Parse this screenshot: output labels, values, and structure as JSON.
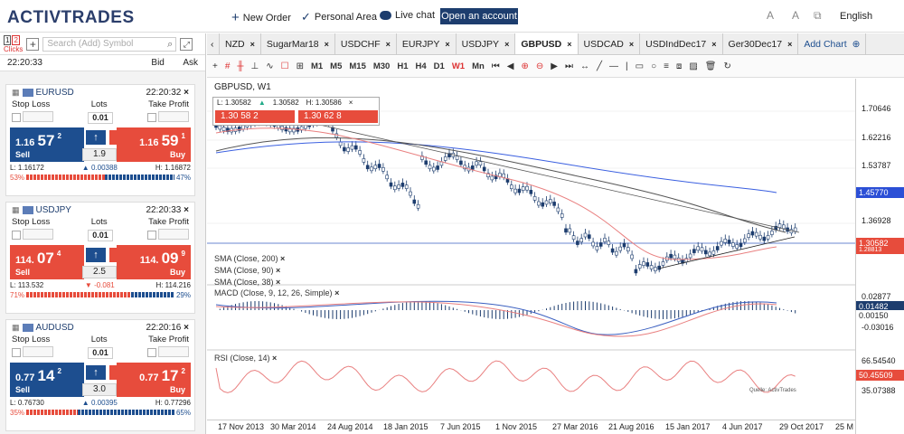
{
  "brand": {
    "logo": "ACTIVTRADES"
  },
  "top": {
    "new_order": "New Order",
    "personal_area": "Personal Area",
    "live_chat": "Live chat",
    "open_account": "Open an account",
    "language": "English"
  },
  "sidebar": {
    "clicks": "Clicks",
    "search_placeholder": "Search (Add) Symbol",
    "time": "22:20:33",
    "bid": "Bid",
    "ask": "Ask",
    "cards": [
      {
        "symbol": "EURUSD",
        "time": "22:20:32",
        "stop_loss": "Stop Loss",
        "lots_label": "Lots",
        "take_profit": "Take Profit",
        "lots": "0.01",
        "sell_int": "1.16",
        "sell_big": "57",
        "sell_sup": "2",
        "buy_int": "1.16",
        "buy_big": "59",
        "buy_sup": "1",
        "sell": "Sell",
        "buy": "Buy",
        "lot_value": "1.9",
        "low": "L: 1.16172",
        "change": "0.00388",
        "high": "H: 1.16872",
        "pct_sell": "53%",
        "pct_buy": "47%",
        "sell_color": "#1d4e8f",
        "buy_color": "#e74c3c"
      },
      {
        "symbol": "USDJPY",
        "time": "22:20:33",
        "stop_loss": "Stop Loss",
        "lots_label": "Lots",
        "take_profit": "Take Profit",
        "lots": "0.01",
        "sell_int": "114.",
        "sell_big": "07",
        "sell_sup": "4",
        "buy_int": "114.",
        "buy_big": "09",
        "buy_sup": "9",
        "sell": "Sell",
        "buy": "Buy",
        "lot_value": "2.5",
        "low": "L: 113.532",
        "change": "-0.081",
        "high": "H: 114.216",
        "pct_sell": "71%",
        "pct_buy": "29%",
        "sell_color": "#e74c3c",
        "buy_color": "#e74c3c"
      },
      {
        "symbol": "AUDUSD",
        "time": "22:20:16",
        "stop_loss": "Stop Loss",
        "lots_label": "Lots",
        "take_profit": "Take Profit",
        "lots": "0.01",
        "sell_int": "0.77",
        "sell_big": "14",
        "sell_sup": "2",
        "buy_int": "0.77",
        "buy_big": "17",
        "buy_sup": "2",
        "sell": "Sell",
        "buy": "Buy",
        "lot_value": "3.0",
        "low": "L: 0.76730",
        "change": "0.00395",
        "high": "H: 0.77296",
        "pct_sell": "35%",
        "pct_buy": "65%",
        "sell_color": "#1d4e8f",
        "buy_color": "#e74c3c"
      }
    ]
  },
  "tabs": [
    "NZD",
    "SugarMar18",
    "USDCHF",
    "EURJPY",
    "USDJPY",
    "GBPUSD",
    "USDCAD",
    "USDIndDec17",
    "Ger30Dec17"
  ],
  "active_tab": "GBPUSD",
  "add_chart": "Add Chart",
  "toolbar": {
    "timeframes": [
      "M1",
      "M5",
      "M15",
      "M30",
      "H1",
      "H4",
      "D1",
      "W1",
      "Mn"
    ],
    "active_tf": "W1"
  },
  "chart": {
    "title": "GBPUSD, W1",
    "low": "L: 1.30582",
    "open": "1.30582",
    "high": "H: 1.30586",
    "bid": "1.30 58 2",
    "ask": "1.30 62 8",
    "indicators": [
      "SMA (Close, 200)",
      "SMA (Close, 90)",
      "SMA (Close, 38)"
    ],
    "macd": "MACD (Close, 9, 12, 26, Simple)",
    "rsi": "RSI (Close, 14)",
    "watermark": "Quelle: ActivTrades",
    "price_axis": [
      "1.70646",
      "1.62216",
      "1.53787",
      "1.45770",
      "1.36928",
      "1.30582",
      "1.28813"
    ],
    "macd_axis": [
      "0.02877",
      "0.01482",
      "0.00150",
      "-0.03016"
    ],
    "rsi_axis": [
      "66.54540",
      "50.45509",
      "35.07388"
    ],
    "dates": [
      "17 Nov 2013",
      "30 Mar 2014",
      "24 Aug 2014",
      "18 Jan 2015",
      "7 Jun 2015",
      "1 Nov 2015",
      "27 Mar 2016",
      "21 Aug 2016",
      "15 Jan 2017",
      "4 Jun 2017",
      "29 Oct 2017",
      "25 M"
    ]
  }
}
